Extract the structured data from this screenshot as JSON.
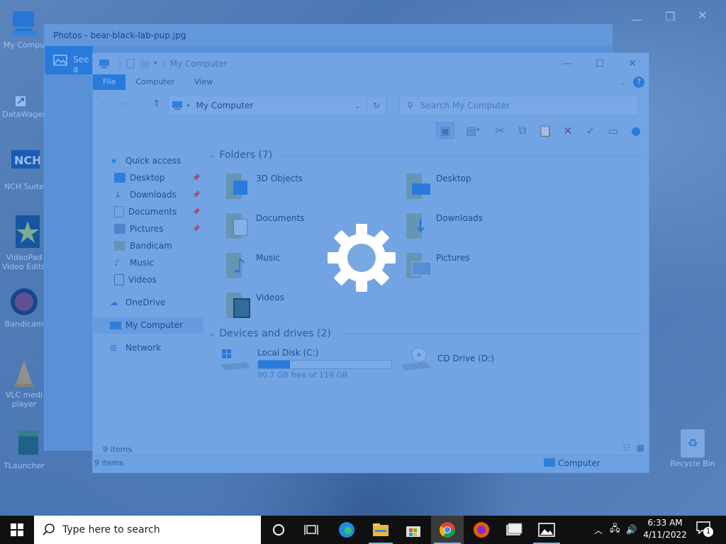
{
  "desktop": {
    "icons": [
      {
        "label": "My Compu"
      },
      {
        "label": "DataWager"
      },
      {
        "label": "NCH Suite"
      },
      {
        "label": "VideoPad Video Edito"
      },
      {
        "label": "Bandicam"
      },
      {
        "label": "VLC medi player"
      },
      {
        "label": "TLauncher"
      }
    ],
    "recycle_bin": "Recycle Bin"
  },
  "photos_window": {
    "title": "Photos - bear-black-lab-pup.jpg",
    "see_all_label": "See a"
  },
  "explorer": {
    "title": "My Computer",
    "tabs": [
      "File",
      "Computer",
      "View"
    ],
    "address": "My Computer",
    "search_placeholder": "Search My Computer",
    "nav": {
      "quick_access": "Quick access",
      "quick_items": [
        {
          "label": "Desktop",
          "pinned": true
        },
        {
          "label": "Downloads",
          "pinned": true
        },
        {
          "label": "Documents",
          "pinned": true
        },
        {
          "label": "Pictures",
          "pinned": true
        },
        {
          "label": "Bandicam",
          "pinned": false
        },
        {
          "label": "Music",
          "pinned": false
        },
        {
          "label": "Videos",
          "pinned": false
        }
      ],
      "onedrive": "OneDrive",
      "my_computer": "My Computer",
      "network": "Network"
    },
    "folders_header": "Folders (7)",
    "folders": [
      "3D Objects",
      "Desktop",
      "Documents",
      "Downloads",
      "Music",
      "Pictures",
      "Videos"
    ],
    "drives_header": "Devices and drives (2)",
    "drives": [
      {
        "name": "Local Disk (C:)",
        "free_text": "90.7 GB free of 119 GB",
        "used_fraction": 0.24
      },
      {
        "name": "CD Drive (D:)"
      }
    ],
    "status_items": "9 items",
    "status_items2": "9 items",
    "status_location": "Computer"
  },
  "taskbar": {
    "search_placeholder": "Type here to search",
    "time": "6:33 AM",
    "date": "4/11/2022",
    "notification_count": "1"
  },
  "colors": {
    "file_tab": "#2f84dd",
    "taskbar": "#101010",
    "overlay_tint": "#1e6ed7"
  }
}
